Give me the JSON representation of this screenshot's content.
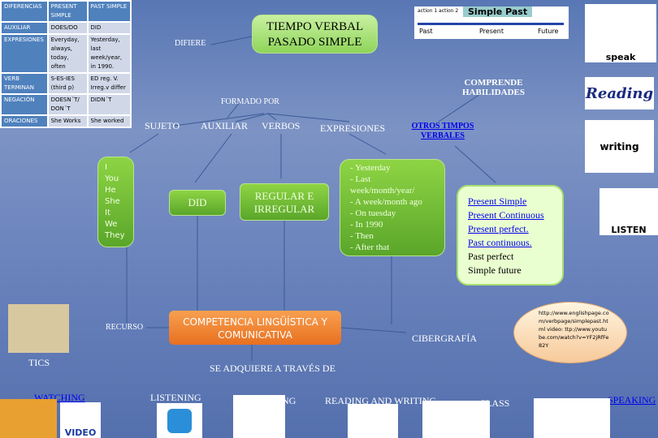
{
  "table": {
    "headers": [
      "DIFERENCIAS",
      "PRESENT SIMPLE",
      "PAST SIMPLE"
    ],
    "rows": [
      [
        "AUXILIAR",
        "DOES/DO",
        "DID"
      ],
      [
        "EXPRESIONES",
        "Everyday, always, today, often",
        "Yesterday, last week/year, in 1990."
      ],
      [
        "VERB TERMINAN",
        "S-ES-IES (third p)",
        "ED reg. V. Irreg.v differ"
      ],
      [
        "NEGACIÓN",
        "DOESN´T/ DON´T",
        "DIDN´T"
      ],
      [
        "ORACIONES",
        "She Works",
        "She worked"
      ]
    ]
  },
  "title": "TIEMPO VERBAL PASADO SIMPLE",
  "difiere": "DIFIERE",
  "formado_por": "FORMADO POR",
  "comprende": "COMPRENDE HABILIDADES",
  "timeline": {
    "title": "Simple Past",
    "action1": "action 1",
    "action2": "action 2",
    "past": "Past",
    "present": "Present",
    "future": "Future"
  },
  "branches": {
    "sujeto": "SUJETO",
    "auxiliar": "AUXILIAR",
    "verbos": "VERBOS",
    "expresiones": "EXPRESIONES",
    "otros": "OTROS TIMPOS VERBALES"
  },
  "subjects": [
    "I",
    "You",
    "He",
    "She",
    "It",
    "We",
    "They"
  ],
  "did": "DID",
  "regular": "REGULAR E IRREGULAR",
  "expressions": [
    "- Yesterday",
    "- Last week/month/year/",
    "- A week/month ago",
    "- On tuesday",
    "- In 1990",
    "- Then",
    "- After that"
  ],
  "tenses": [
    {
      "label": "Present Simple",
      "link": true
    },
    {
      "label": "Present Continuous",
      "link": true
    },
    {
      "label": "Present perfect.",
      "link": true
    },
    {
      "label": "Past continuous.",
      "link": true
    },
    {
      "label": "Past perfect",
      "link": false
    },
    {
      "label": "Simple future",
      "link": false
    }
  ],
  "recurso": "RECURSO",
  "competencia": "COMPETENCIA LINGÜÍSTICA Y COMUNICATIVA",
  "cibergrafia": "CIBERGRAFÍA",
  "cyber_text": "http://www.englishpage.com/verbpage/simplepast.html video: ttp://www.youtube.com/watch?v=YF2jRfFe82Y",
  "tics": "TICS",
  "adquiere": "SE ADQUIERE A TRAVÉS DE",
  "skills": {
    "watching": "WATCHING",
    "listening": "LISTENING",
    "singing": "SINGING",
    "reading_writing": "READING AND WRITING",
    "class": "CLASS",
    "speaking": "SPEAKING"
  },
  "icons": {
    "speak": "speak",
    "reading": "Reading",
    "writing": "writing",
    "listen": "LISTEN",
    "video": "VIDEO"
  }
}
